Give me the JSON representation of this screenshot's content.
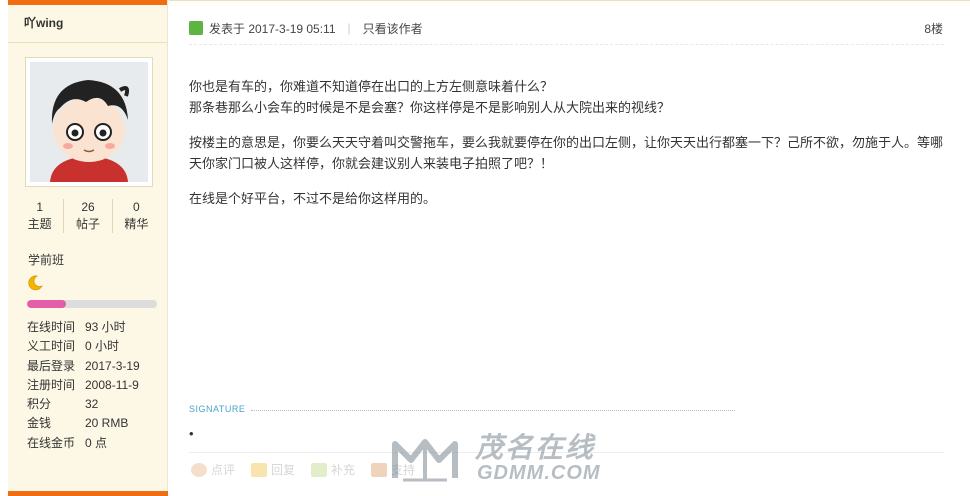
{
  "author": {
    "name": "吖wing",
    "stats": [
      {
        "value": "1",
        "label": "主题"
      },
      {
        "value": "26",
        "label": "帖子"
      },
      {
        "value": "0",
        "label": "精华"
      }
    ],
    "rank": "学前班",
    "level_progress": 0.3,
    "level_bar_color": "#e35da8",
    "info": [
      {
        "key": "在线时间",
        "value": "93 小时"
      },
      {
        "key": "义工时间",
        "value": "0 小时"
      },
      {
        "key": "最后登录",
        "value": "2017-3-19"
      },
      {
        "key": "注册时间",
        "value": "2008-11-9"
      },
      {
        "key": "积分",
        "value": "32"
      },
      {
        "key": "金钱",
        "value": "20 RMB"
      },
      {
        "key": "在线金币",
        "value": "0 点"
      }
    ]
  },
  "post": {
    "meta": "发表于 2017-3-19 05:11",
    "only_author": "只看该作者",
    "floor": "8楼",
    "paragraphs": [
      "你也是有车的，你难道不知道停在出口的上方左侧意味着什么？\n那条巷那么小会车的时候是不是会塞？你这样停是不是影响别人从大院出来的视线？",
      "按楼主的意思是，你要么天天守着叫交警拖车，要么我就要停在你的出口左侧，让你天天出行都塞一下？己所不欲，勿施于人。等哪天你家门口被人这样停，你就会建议别人来装电子拍照了吧？！",
      "在线是个好平台，不过不是给你这样用的。"
    ],
    "signature_label": "SIGNATURE",
    "signature_bullet": "•",
    "actions": [
      "点评",
      "回复",
      "补充",
      "支持"
    ]
  },
  "watermark": {
    "cn": "茂名在线",
    "en": "GDMM.COM"
  },
  "colors": {
    "accent": "#f26c12",
    "sidebar_bg": "#fdf8e6",
    "signature": "#4aa3c9"
  }
}
